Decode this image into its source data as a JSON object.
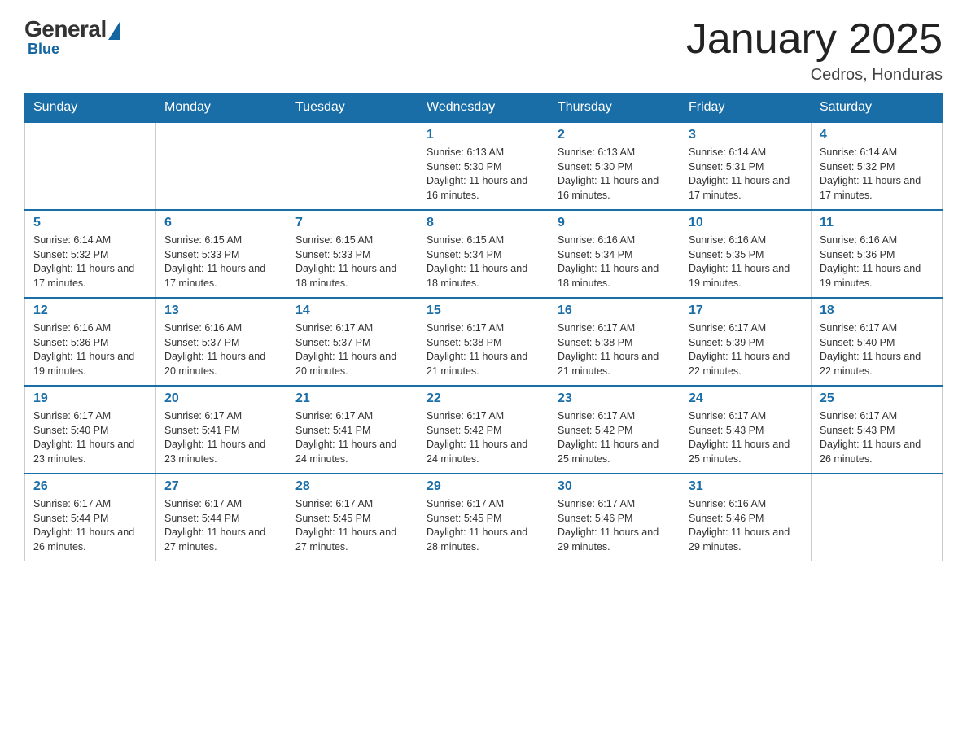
{
  "header": {
    "logo_general": "General",
    "logo_blue": "Blue",
    "month_title": "January 2025",
    "location": "Cedros, Honduras"
  },
  "days_of_week": [
    "Sunday",
    "Monday",
    "Tuesday",
    "Wednesday",
    "Thursday",
    "Friday",
    "Saturday"
  ],
  "weeks": [
    [
      {
        "day": "",
        "info": ""
      },
      {
        "day": "",
        "info": ""
      },
      {
        "day": "",
        "info": ""
      },
      {
        "day": "1",
        "info": "Sunrise: 6:13 AM\nSunset: 5:30 PM\nDaylight: 11 hours and 16 minutes."
      },
      {
        "day": "2",
        "info": "Sunrise: 6:13 AM\nSunset: 5:30 PM\nDaylight: 11 hours and 16 minutes."
      },
      {
        "day": "3",
        "info": "Sunrise: 6:14 AM\nSunset: 5:31 PM\nDaylight: 11 hours and 17 minutes."
      },
      {
        "day": "4",
        "info": "Sunrise: 6:14 AM\nSunset: 5:32 PM\nDaylight: 11 hours and 17 minutes."
      }
    ],
    [
      {
        "day": "5",
        "info": "Sunrise: 6:14 AM\nSunset: 5:32 PM\nDaylight: 11 hours and 17 minutes."
      },
      {
        "day": "6",
        "info": "Sunrise: 6:15 AM\nSunset: 5:33 PM\nDaylight: 11 hours and 17 minutes."
      },
      {
        "day": "7",
        "info": "Sunrise: 6:15 AM\nSunset: 5:33 PM\nDaylight: 11 hours and 18 minutes."
      },
      {
        "day": "8",
        "info": "Sunrise: 6:15 AM\nSunset: 5:34 PM\nDaylight: 11 hours and 18 minutes."
      },
      {
        "day": "9",
        "info": "Sunrise: 6:16 AM\nSunset: 5:34 PM\nDaylight: 11 hours and 18 minutes."
      },
      {
        "day": "10",
        "info": "Sunrise: 6:16 AM\nSunset: 5:35 PM\nDaylight: 11 hours and 19 minutes."
      },
      {
        "day": "11",
        "info": "Sunrise: 6:16 AM\nSunset: 5:36 PM\nDaylight: 11 hours and 19 minutes."
      }
    ],
    [
      {
        "day": "12",
        "info": "Sunrise: 6:16 AM\nSunset: 5:36 PM\nDaylight: 11 hours and 19 minutes."
      },
      {
        "day": "13",
        "info": "Sunrise: 6:16 AM\nSunset: 5:37 PM\nDaylight: 11 hours and 20 minutes."
      },
      {
        "day": "14",
        "info": "Sunrise: 6:17 AM\nSunset: 5:37 PM\nDaylight: 11 hours and 20 minutes."
      },
      {
        "day": "15",
        "info": "Sunrise: 6:17 AM\nSunset: 5:38 PM\nDaylight: 11 hours and 21 minutes."
      },
      {
        "day": "16",
        "info": "Sunrise: 6:17 AM\nSunset: 5:38 PM\nDaylight: 11 hours and 21 minutes."
      },
      {
        "day": "17",
        "info": "Sunrise: 6:17 AM\nSunset: 5:39 PM\nDaylight: 11 hours and 22 minutes."
      },
      {
        "day": "18",
        "info": "Sunrise: 6:17 AM\nSunset: 5:40 PM\nDaylight: 11 hours and 22 minutes."
      }
    ],
    [
      {
        "day": "19",
        "info": "Sunrise: 6:17 AM\nSunset: 5:40 PM\nDaylight: 11 hours and 23 minutes."
      },
      {
        "day": "20",
        "info": "Sunrise: 6:17 AM\nSunset: 5:41 PM\nDaylight: 11 hours and 23 minutes."
      },
      {
        "day": "21",
        "info": "Sunrise: 6:17 AM\nSunset: 5:41 PM\nDaylight: 11 hours and 24 minutes."
      },
      {
        "day": "22",
        "info": "Sunrise: 6:17 AM\nSunset: 5:42 PM\nDaylight: 11 hours and 24 minutes."
      },
      {
        "day": "23",
        "info": "Sunrise: 6:17 AM\nSunset: 5:42 PM\nDaylight: 11 hours and 25 minutes."
      },
      {
        "day": "24",
        "info": "Sunrise: 6:17 AM\nSunset: 5:43 PM\nDaylight: 11 hours and 25 minutes."
      },
      {
        "day": "25",
        "info": "Sunrise: 6:17 AM\nSunset: 5:43 PM\nDaylight: 11 hours and 26 minutes."
      }
    ],
    [
      {
        "day": "26",
        "info": "Sunrise: 6:17 AM\nSunset: 5:44 PM\nDaylight: 11 hours and 26 minutes."
      },
      {
        "day": "27",
        "info": "Sunrise: 6:17 AM\nSunset: 5:44 PM\nDaylight: 11 hours and 27 minutes."
      },
      {
        "day": "28",
        "info": "Sunrise: 6:17 AM\nSunset: 5:45 PM\nDaylight: 11 hours and 27 minutes."
      },
      {
        "day": "29",
        "info": "Sunrise: 6:17 AM\nSunset: 5:45 PM\nDaylight: 11 hours and 28 minutes."
      },
      {
        "day": "30",
        "info": "Sunrise: 6:17 AM\nSunset: 5:46 PM\nDaylight: 11 hours and 29 minutes."
      },
      {
        "day": "31",
        "info": "Sunrise: 6:16 AM\nSunset: 5:46 PM\nDaylight: 11 hours and 29 minutes."
      },
      {
        "day": "",
        "info": ""
      }
    ]
  ]
}
